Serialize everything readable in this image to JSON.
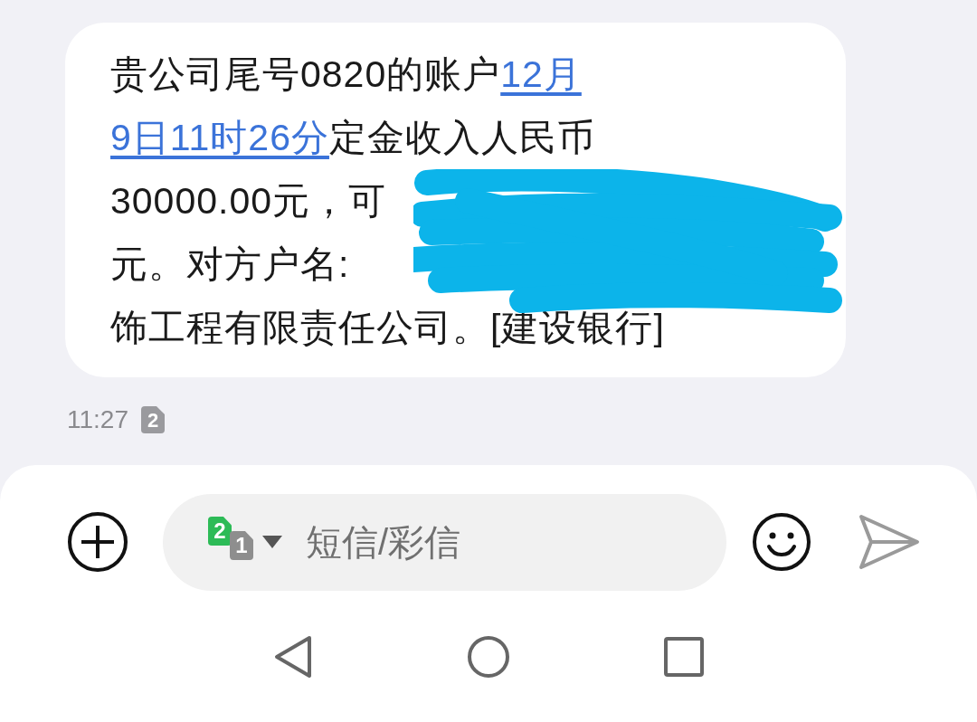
{
  "message": {
    "lines": [
      [
        {
          "kind": "text",
          "text": "贵公司尾号0820的账户"
        },
        {
          "kind": "link",
          "text": "12月"
        }
      ],
      [
        {
          "kind": "link",
          "text": "9日11时26分"
        },
        {
          "kind": "text",
          "text": "定金收入人民币"
        }
      ],
      [
        {
          "kind": "text",
          "text": "30000.00元，可"
        }
      ],
      [
        {
          "kind": "text",
          "text": "元。对方户名:"
        }
      ],
      [
        {
          "kind": "text",
          "text": "饰工程有限责任公司。[建设银行]"
        }
      ]
    ],
    "redacted": true,
    "time": "11:27",
    "sim": "2"
  },
  "composer": {
    "sim_primary": "2",
    "sim_secondary": "1",
    "placeholder": "短信/彩信"
  }
}
